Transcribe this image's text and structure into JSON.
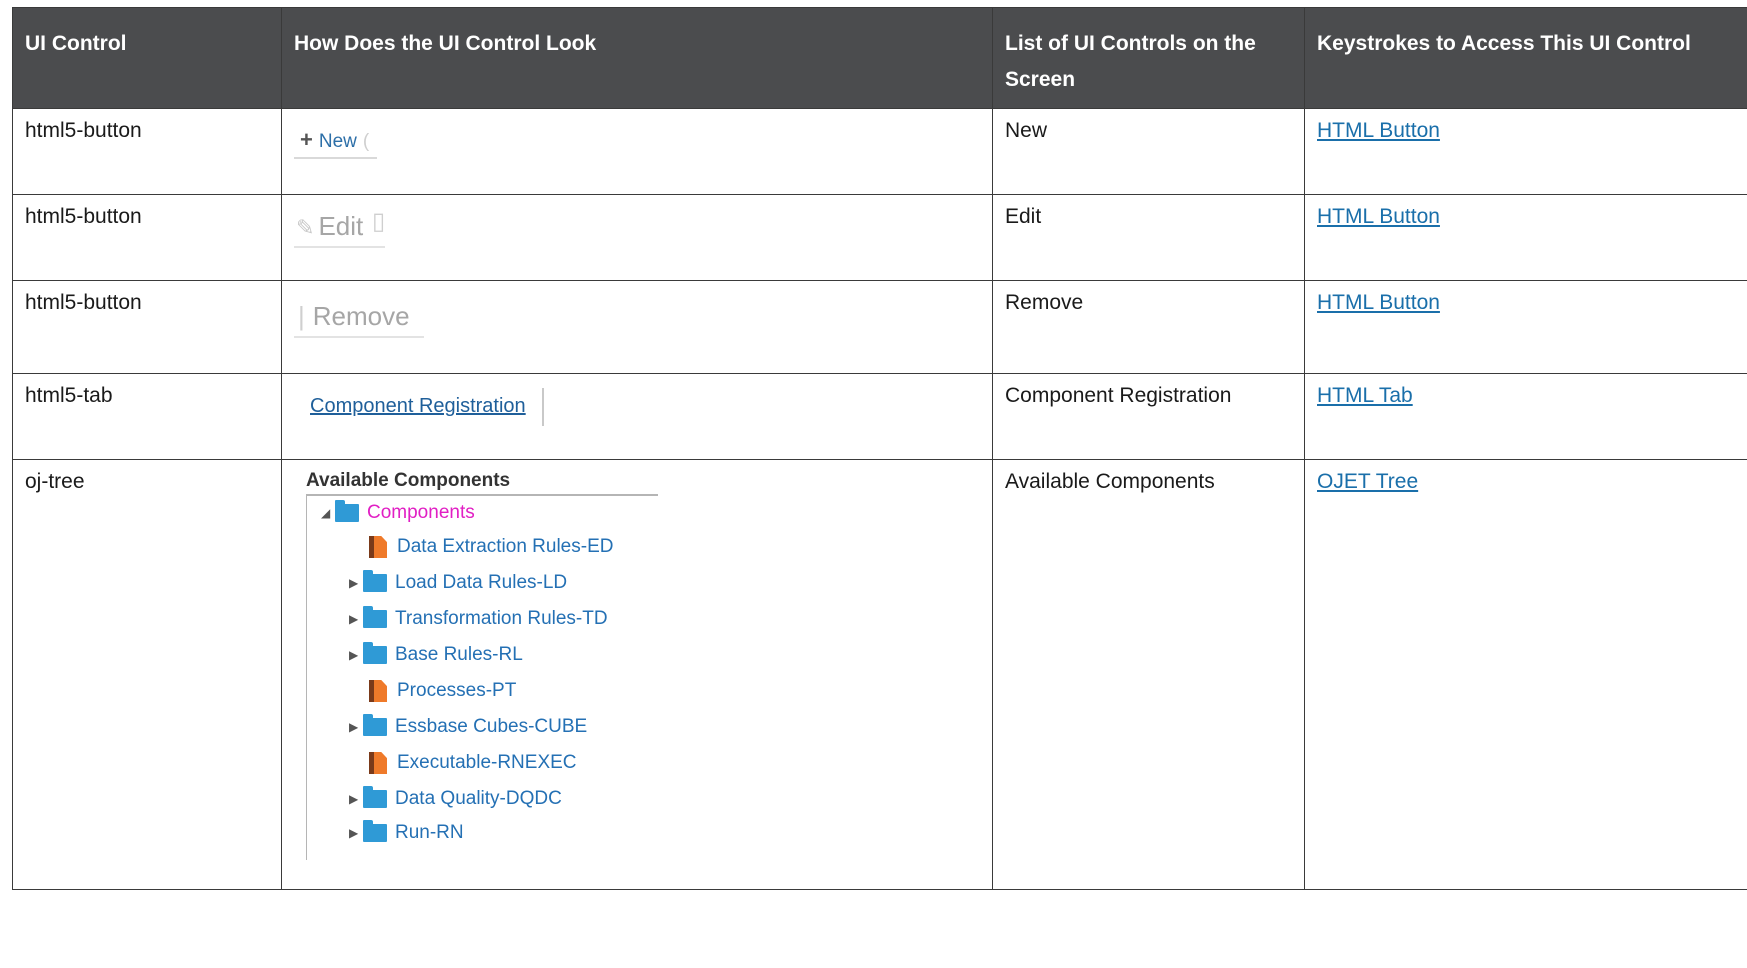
{
  "headers": {
    "col1": "UI Control",
    "col2": "How Does the UI Control Look",
    "col3": "List of UI Controls on the Screen",
    "col4": "Keystrokes to Access This UI Control"
  },
  "rows": [
    {
      "control": "html5-button",
      "list_name": "New",
      "keystroke_link": "HTML Button",
      "preview_label": "New"
    },
    {
      "control": "html5-button",
      "list_name": "Edit",
      "keystroke_link": "HTML Button",
      "preview_label": "Edit"
    },
    {
      "control": "html5-button",
      "list_name": "Remove",
      "keystroke_link": "HTML Button",
      "preview_label": "Remove"
    },
    {
      "control": "html5-tab",
      "list_name": "Component Registration",
      "keystroke_link": "HTML Tab",
      "preview_label": "Component Registration"
    },
    {
      "control": "oj-tree",
      "list_name": "Available Components",
      "keystroke_link": "OJET Tree",
      "preview_label": "Available Components"
    }
  ],
  "tree": {
    "root": {
      "label": "Components",
      "icon": "folder-icon",
      "expanded": true
    },
    "children": [
      {
        "label": "Data Extraction Rules-ED",
        "icon": "document-icon",
        "expandable": false
      },
      {
        "label": "Load Data Rules-LD",
        "icon": "folder-icon",
        "expandable": true
      },
      {
        "label": "Transformation Rules-TD",
        "icon": "folder-icon",
        "expandable": true
      },
      {
        "label": "Base Rules-RL",
        "icon": "folder-icon",
        "expandable": true
      },
      {
        "label": "Processes-PT",
        "icon": "document-icon",
        "expandable": false
      },
      {
        "label": "Essbase Cubes-CUBE",
        "icon": "folder-icon",
        "expandable": true
      },
      {
        "label": "Executable-RNEXEC",
        "icon": "document-icon",
        "expandable": false
      },
      {
        "label": "Data Quality-DQDC",
        "icon": "folder-icon",
        "expandable": true
      },
      {
        "label": "Run-RN",
        "icon": "folder-icon",
        "expandable": true
      }
    ]
  },
  "colors": {
    "header_bg": "#4b4c4e",
    "link": "#1a6faa",
    "tree_root": "#e11fc4",
    "tree_item": "#2470b4",
    "folder": "#2f9ad6",
    "document": "#ef7a2a"
  }
}
